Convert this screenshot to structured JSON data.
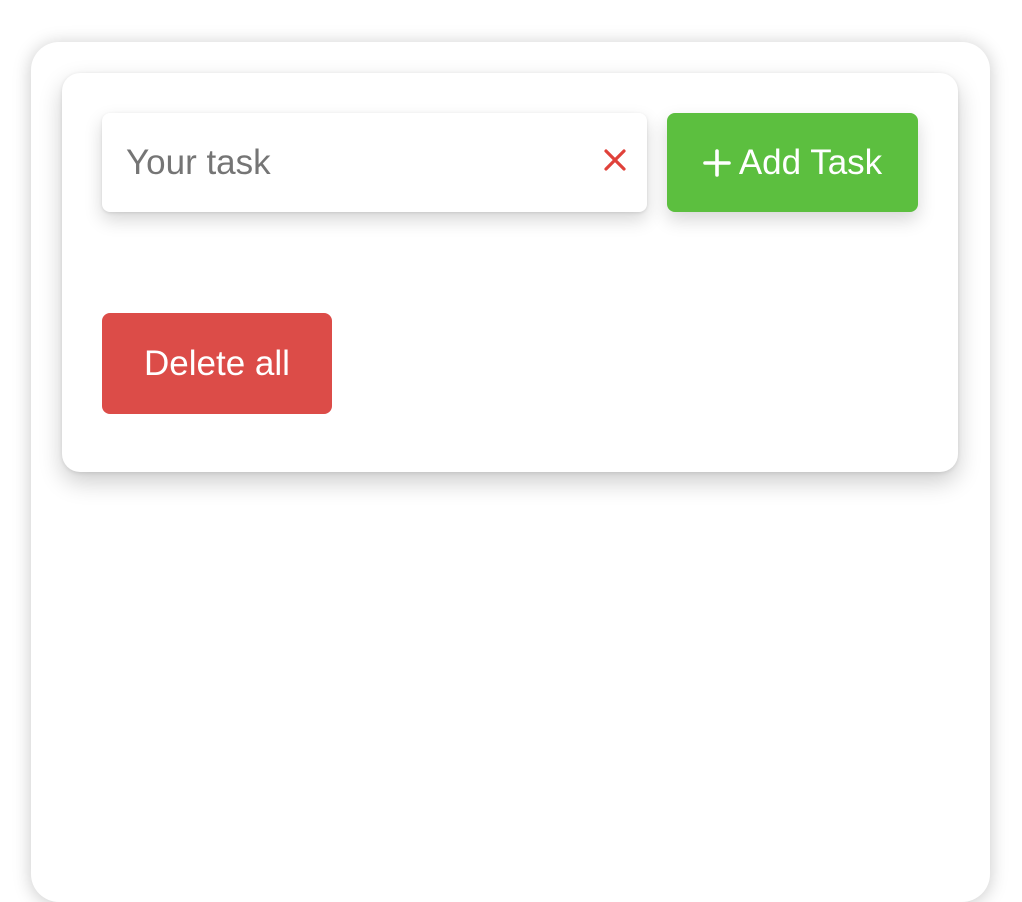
{
  "task_form": {
    "input": {
      "value": "",
      "placeholder": "Your task",
      "clear_icon": "close-icon"
    },
    "add_button": {
      "icon": "plus-icon",
      "label": "Add Task"
    }
  },
  "actions": {
    "delete_all_label": "Delete all"
  },
  "colors": {
    "add_button": "#5cbf3f",
    "delete_button": "#dc4c48",
    "clear_icon": "#e0413a",
    "placeholder": "#757575"
  }
}
